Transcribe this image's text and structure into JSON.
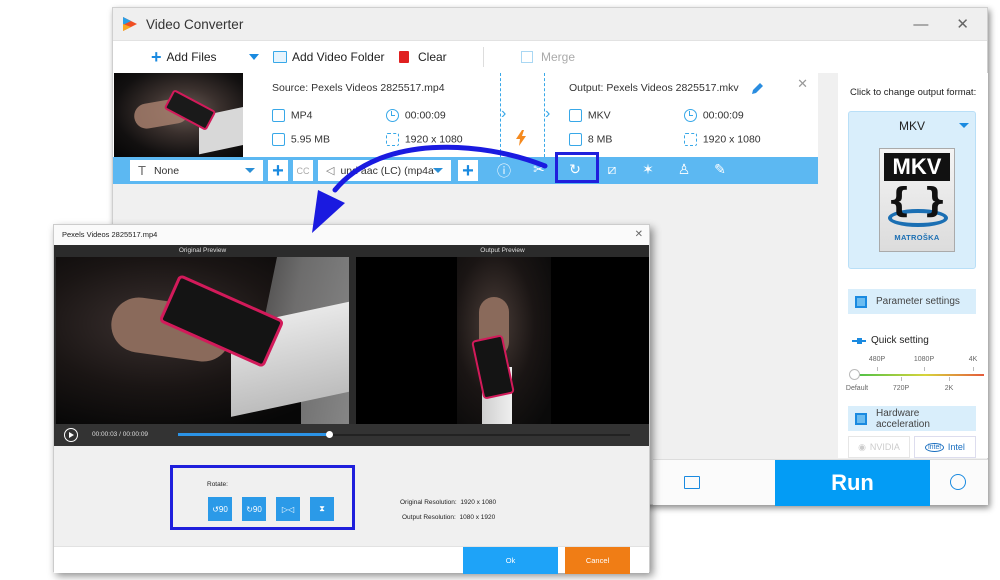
{
  "app": {
    "title": "Video Converter",
    "minimize_glyph": "—",
    "close_glyph": "✕"
  },
  "toolbar": {
    "add_files": "Add Files",
    "add_video_folder": "Add Video Folder",
    "clear": "Clear",
    "merge": "Merge"
  },
  "file_item": {
    "source_label": "Source: Pexels Videos 2825517.mp4",
    "source_format": "MP4",
    "source_duration": "00:00:09",
    "source_size": "5.95 MB",
    "source_resolution": "1920 x 1080",
    "output_label": "Output: Pexels Videos 2825517.mkv",
    "output_format": "MKV",
    "output_duration": "00:00:09",
    "output_size": "8 MB",
    "output_resolution": "1920 x 1080",
    "remove_glyph": "✕"
  },
  "edit_bar": {
    "subtitle_select": "None",
    "audio_select": "und aac (LC) (mp4a",
    "cc_label": "CC",
    "icons": [
      "info-icon",
      "cut-icon",
      "rotate-icon",
      "crop-icon",
      "effects-icon",
      "watermark-icon",
      "edit-subtitle-icon"
    ]
  },
  "right_panel": {
    "format_prompt": "Click to change output format:",
    "format_selected": "MKV",
    "format_logo_top": "MKV",
    "format_logo_braces": "{ }",
    "format_logo_text": "MATROŠKA",
    "parameter_settings": "Parameter settings",
    "quick_setting": "Quick setting",
    "quality_ticks_top": [
      "480P",
      "1080P",
      "4K"
    ],
    "quality_ticks_bottom": [
      "Default",
      "720P",
      "2K"
    ],
    "quality_selected": "Default",
    "hardware_acceleration": "Hardware acceleration",
    "nvidia": "NVIDIA",
    "intel": "Intel"
  },
  "bottom": {
    "run": "Run"
  },
  "dialog": {
    "title": "Pexels Videos 2825517.mp4",
    "close_glyph": "✕",
    "original_preview": "Original Preview",
    "output_preview": "Output Preview",
    "current_time": "00:00:03",
    "time_separator": "/",
    "total_time": "00:00:09",
    "progress_fraction": 0.3333,
    "rotate_label": "Rotate:",
    "rotate_buttons": [
      {
        "name": "rotate-left-90",
        "glyph": "↺90"
      },
      {
        "name": "rotate-right-90",
        "glyph": "↻90"
      },
      {
        "name": "flip-horizontal",
        "glyph": "▷◁"
      },
      {
        "name": "flip-vertical",
        "glyph": "⧗"
      }
    ],
    "original_resolution_label": "Original Resolution:",
    "original_resolution": "1920 x 1080",
    "output_resolution_label": "Output Resolution:",
    "output_resolution": "1080 x 1920",
    "ok": "Ok",
    "cancel": "Cancel"
  },
  "colors": {
    "accent": "#039cf5",
    "edit_bar": "#5cb8f2",
    "cancel": "#f07d15",
    "annotation": "#1f1fdc"
  }
}
